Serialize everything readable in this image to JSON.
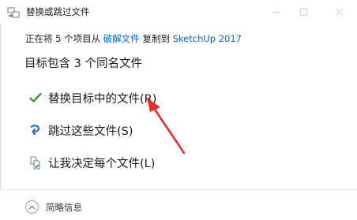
{
  "window": {
    "title": "替换或跳过文件"
  },
  "info": {
    "prefix": "正在将 5 个项目从 ",
    "source": "破解文件",
    "middle": " 复制到 ",
    "destination": "SketchUp 2017"
  },
  "heading": "目标包含 3 个同名文件",
  "options": [
    {
      "label": "替换目标中的文件(R)",
      "icon": "checkmark-icon"
    },
    {
      "label": "跳过这些文件(S)",
      "icon": "skip-arrow-icon"
    },
    {
      "label": "让我决定每个文件(L)",
      "icon": "compare-files-icon"
    }
  ],
  "footer": {
    "details_label": "简略信息",
    "icon": "chevron-up-icon"
  },
  "colors": {
    "link": "#0066cc",
    "check": "#2e8b3a",
    "skip": "#2a6fc9",
    "annotation_arrow": "#e0302a"
  }
}
